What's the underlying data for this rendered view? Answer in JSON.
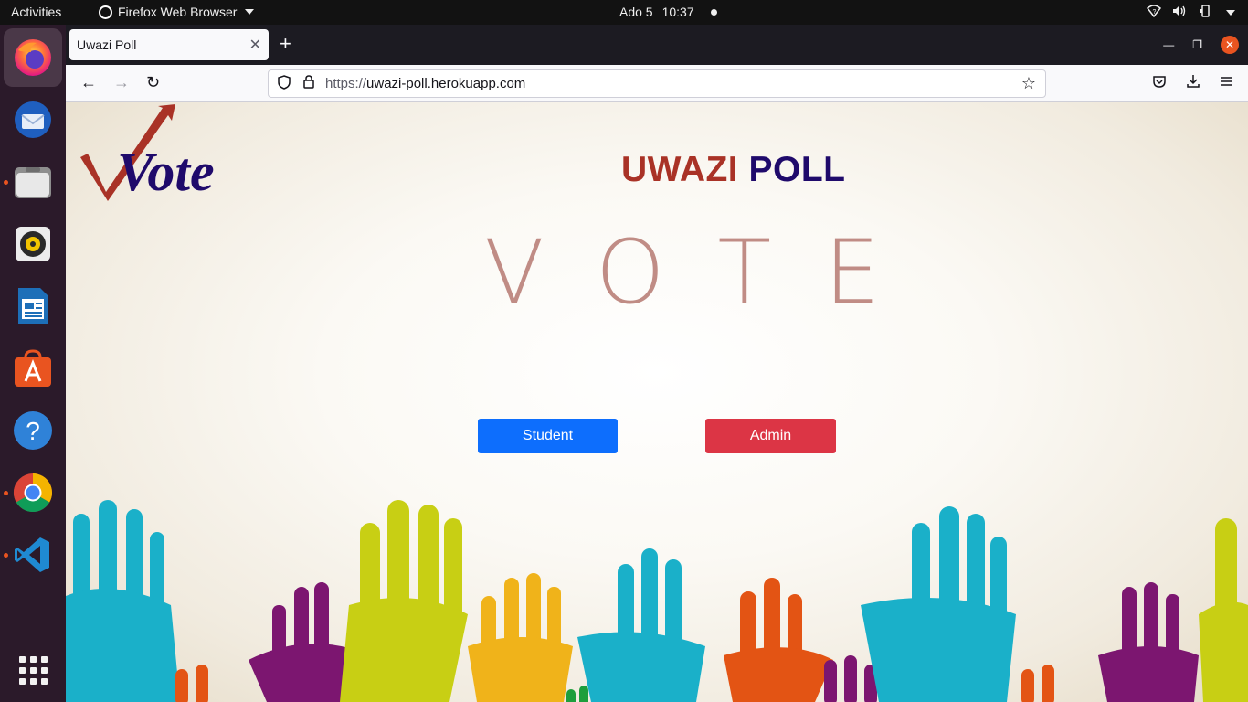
{
  "topbar": {
    "activities": "Activities",
    "app_menu": "Firefox Web Browser",
    "date": "Ado 5",
    "time": "10:37"
  },
  "dock": {
    "apps": [
      "firefox",
      "thunderbird",
      "files",
      "rhythmbox",
      "libreoffice-writer",
      "ubuntu-software",
      "help",
      "chrome",
      "vscode",
      "show-applications"
    ]
  },
  "browser": {
    "tab_title": "Uwazi Poll",
    "url_scheme": "https://",
    "url_host": "uwazi-poll.herokuapp.com"
  },
  "page": {
    "logo_text": "Vote",
    "title_part1": "UWAZI",
    "title_part2": "POLL",
    "banner_word": "VOTE",
    "student_button": "Student",
    "admin_button": "Admin"
  },
  "colors": {
    "title_red": "#a93226",
    "title_navy": "#1f0a6b",
    "student_blue": "#0d6efd",
    "admin_red": "#dc3545",
    "ubuntu_orange": "#e95420"
  }
}
